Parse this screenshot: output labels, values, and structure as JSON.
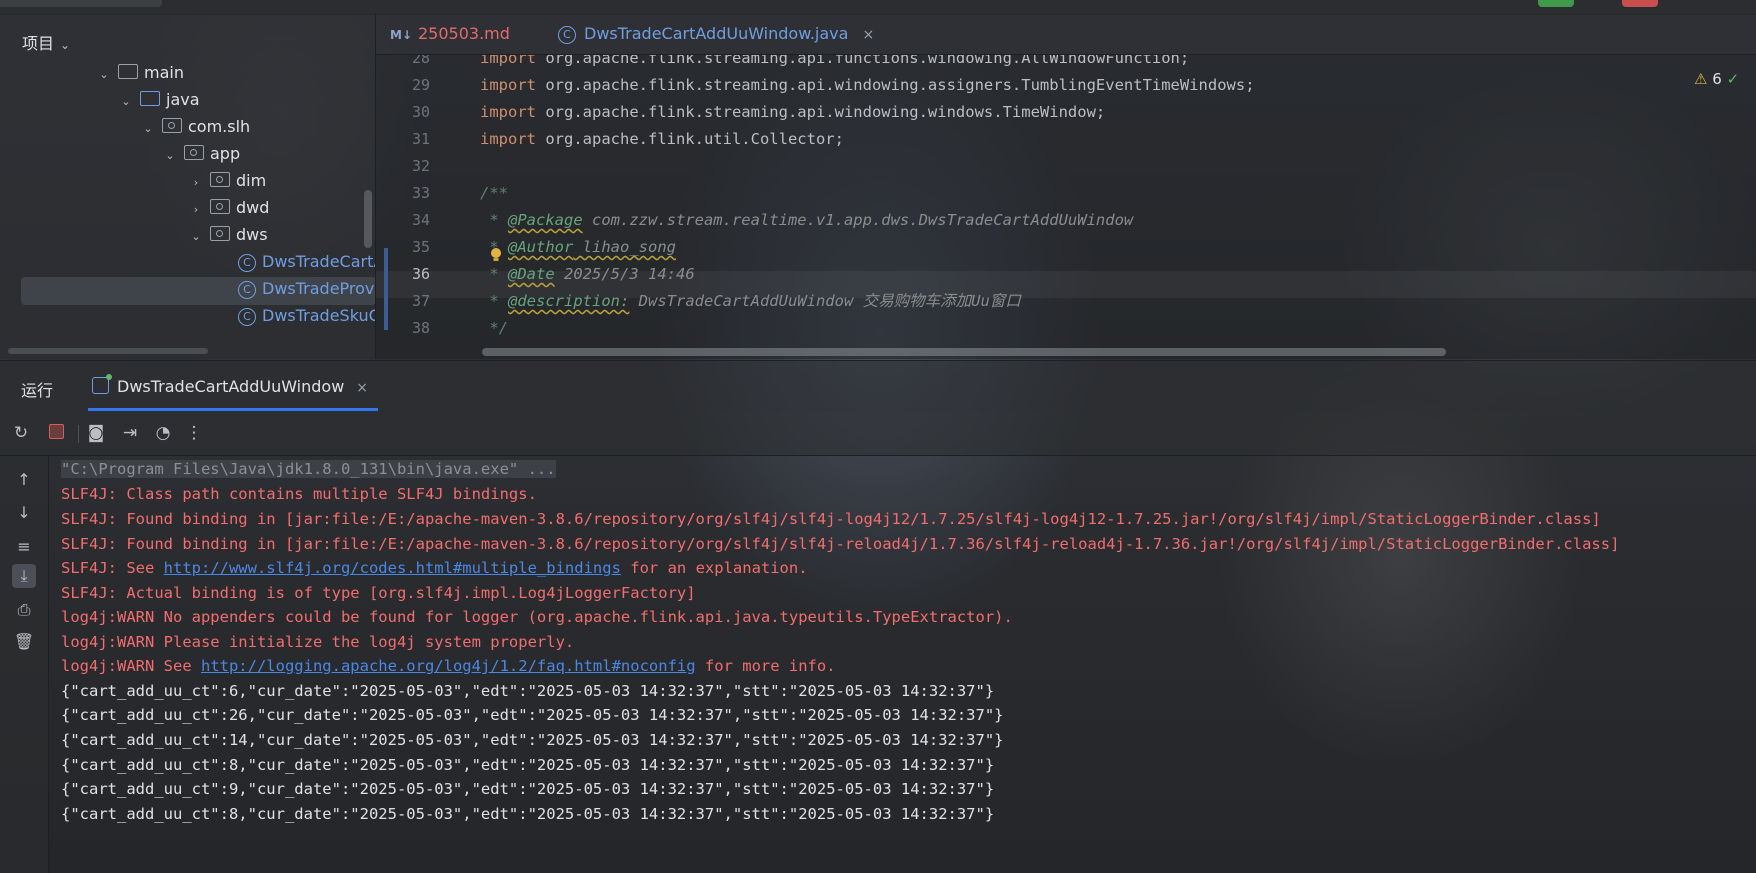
{
  "project_panel": {
    "title": "项目",
    "tree": [
      {
        "label": "main",
        "expanded": true
      },
      {
        "label": "java",
        "expanded": true
      },
      {
        "label": "com.slh",
        "expanded": true
      },
      {
        "label": "app",
        "expanded": true
      },
      {
        "label": "dim",
        "expanded": false
      },
      {
        "label": "dwd",
        "expanded": false
      },
      {
        "label": "dws",
        "expanded": true
      },
      {
        "label": "DwsTradeCartA",
        "selected": true
      },
      {
        "label": "DwsTradeProv"
      },
      {
        "label": "DwsTradeSkuC"
      }
    ]
  },
  "editor": {
    "tabs": [
      {
        "badge": "M↓",
        "label": "250503.md"
      },
      {
        "label": "DwsTradeCartAddUuWindow.java",
        "close": "×"
      }
    ],
    "warnings": {
      "count": "6"
    },
    "lines": [
      {
        "num": "28",
        "kw": "import",
        "text": " org.apache.flink.streaming.api.functions.windowing.AllWindowFunction;"
      },
      {
        "num": "29",
        "kw": "import",
        "text": " org.apache.flink.streaming.api.windowing.assigners.TumblingEventTimeWindows;"
      },
      {
        "num": "30",
        "kw": "import",
        "text": " org.apache.flink.streaming.api.windowing.windows.TimeWindow;"
      },
      {
        "num": "31",
        "kw": "import",
        "text": " org.apache.flink.util.Collector;"
      },
      {
        "num": "32"
      },
      {
        "num": "33",
        "doc": "/**"
      },
      {
        "num": "34",
        "star": " * ",
        "tag": "@Package",
        "val": " com.zzw.stream.realtime.v1.app.dws.DwsTradeCartAddUuWindow"
      },
      {
        "num": "35",
        "star": " * ",
        "tag": "@Author",
        "val": " lihao_song"
      },
      {
        "num": "36",
        "star": " * ",
        "tag": "@Date",
        "val": " 2025/5/3 14:46"
      },
      {
        "num": "37",
        "star": " * ",
        "tag": "@description:",
        "val": " DwsTradeCartAddUuWindow 交易购物车添加Uu窗口"
      },
      {
        "num": "38",
        "doc": " */"
      }
    ]
  },
  "run_panel": {
    "title": "运行",
    "tab_label": "DwsTradeCartAddUuWindow",
    "tab_close": "×",
    "console": [
      {
        "type": "gray",
        "text": "\"C:\\Program Files\\Java\\jdk1.8.0_131\\bin\\java.exe\" ..."
      },
      {
        "type": "red",
        "text": "SLF4J: Class path contains multiple SLF4J bindings."
      },
      {
        "type": "red",
        "text": "SLF4J: Found binding in [jar:file:/E:/apache-maven-3.8.6/repository/org/slf4j/slf4j-log4j12/1.7.25/slf4j-log4j12-1.7.25.jar!/org/slf4j/impl/StaticLoggerBinder.class]"
      },
      {
        "type": "red",
        "text": "SLF4J: Found binding in [jar:file:/E:/apache-maven-3.8.6/repository/org/slf4j/slf4j-reload4j/1.7.36/slf4j-reload4j-1.7.36.jar!/org/slf4j/impl/StaticLoggerBinder.class]"
      },
      {
        "type": "redlink",
        "pre": "SLF4J: See ",
        "link": "http://www.slf4j.org/codes.html#multiple_bindings",
        "post": " for an explanation."
      },
      {
        "type": "red",
        "text": "SLF4J: Actual binding is of type [org.slf4j.impl.Log4jLoggerFactory]"
      },
      {
        "type": "red",
        "text": "log4j:WARN No appenders could be found for logger (org.apache.flink.api.java.typeutils.TypeExtractor)."
      },
      {
        "type": "red",
        "text": "log4j:WARN Please initialize the log4j system properly."
      },
      {
        "type": "redlink",
        "pre": "log4j:WARN See ",
        "link": "http://logging.apache.org/log4j/1.2/faq.html#noconfig",
        "post": " for more info."
      },
      {
        "type": "white",
        "text": "{\"cart_add_uu_ct\":6,\"cur_date\":\"2025-05-03\",\"edt\":\"2025-05-03 14:32:37\",\"stt\":\"2025-05-03 14:32:37\"}"
      },
      {
        "type": "white",
        "text": "{\"cart_add_uu_ct\":26,\"cur_date\":\"2025-05-03\",\"edt\":\"2025-05-03 14:32:37\",\"stt\":\"2025-05-03 14:32:37\"}"
      },
      {
        "type": "white",
        "text": "{\"cart_add_uu_ct\":14,\"cur_date\":\"2025-05-03\",\"edt\":\"2025-05-03 14:32:37\",\"stt\":\"2025-05-03 14:32:37\"}"
      },
      {
        "type": "white",
        "text": "{\"cart_add_uu_ct\":8,\"cur_date\":\"2025-05-03\",\"edt\":\"2025-05-03 14:32:37\",\"stt\":\"2025-05-03 14:32:37\"}"
      },
      {
        "type": "white",
        "text": "{\"cart_add_uu_ct\":9,\"cur_date\":\"2025-05-03\",\"edt\":\"2025-05-03 14:32:37\",\"stt\":\"2025-05-03 14:32:37\"}"
      },
      {
        "type": "white",
        "text": "{\"cart_add_uu_ct\":8,\"cur_date\":\"2025-05-03\",\"edt\":\"2025-05-03 14:32:37\",\"stt\":\"2025-05-03 14:32:37\"}"
      }
    ]
  },
  "colors": {
    "accent": "#3574f0",
    "error_text": "#f26d6d",
    "link": "#4a88e6",
    "keyword": "#cf8e6d",
    "class_icon": "#6f9ee0"
  }
}
